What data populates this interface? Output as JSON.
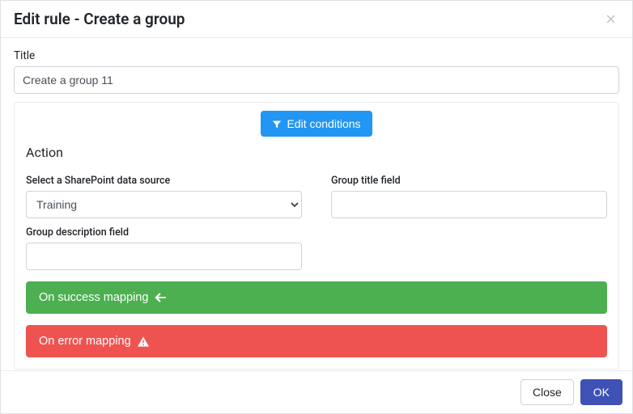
{
  "header": {
    "title": "Edit rule - Create a group"
  },
  "title_field": {
    "label": "Title",
    "value": "Create a group 11"
  },
  "edit_conditions_label": "Edit conditions",
  "action_section_title": "Action",
  "data_source": {
    "label": "Select a SharePoint data source",
    "selected": "Training"
  },
  "group_title": {
    "label": "Group title field",
    "value": ""
  },
  "group_description": {
    "label": "Group description field",
    "value": ""
  },
  "success_bar_label": "On success mapping",
  "error_bar_label": "On error mapping",
  "footer": {
    "close_label": "Close",
    "ok_label": "OK"
  },
  "colors": {
    "primary_blue": "#2196f3",
    "success_green": "#4caf50",
    "error_red": "#ef5350",
    "ok_indigo": "#3f51b5"
  }
}
